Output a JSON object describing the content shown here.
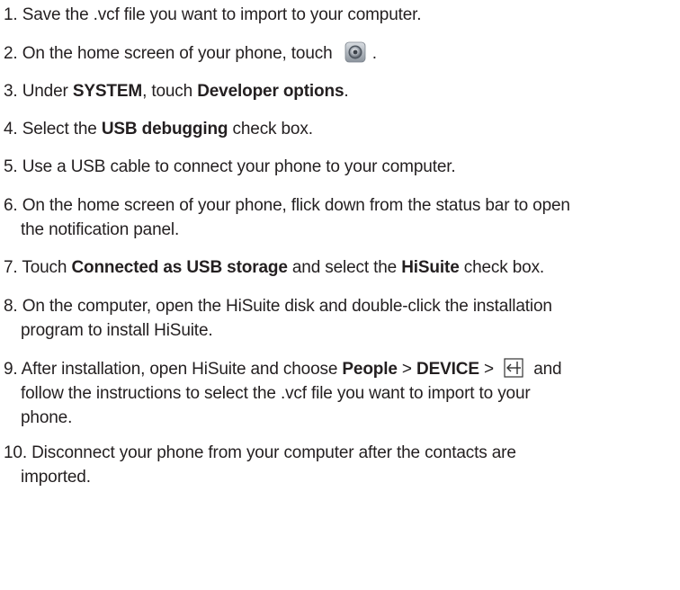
{
  "steps": [
    {
      "num": "1.",
      "segs": [
        {
          "t": "Save the .vcf file you want to import to your computer."
        }
      ]
    },
    {
      "num": "2.",
      "segs": [
        {
          "t": "On the home screen of your phone, touch "
        },
        {
          "icon": "settings-icon"
        },
        {
          "t": " ."
        }
      ]
    },
    {
      "num": "3.",
      "segs": [
        {
          "t": "Under "
        },
        {
          "t": "SYSTEM",
          "b": true
        },
        {
          "t": ", touch "
        },
        {
          "t": "Developer options",
          "b": true
        },
        {
          "t": "."
        }
      ]
    },
    {
      "num": "4.",
      "segs": [
        {
          "t": "Select the "
        },
        {
          "t": "USB debugging",
          "b": true
        },
        {
          "t": " check box."
        }
      ]
    },
    {
      "num": "5.",
      "segs": [
        {
          "t": "Use a USB cable to connect your phone to your computer."
        }
      ]
    },
    {
      "num": "6.",
      "segs": [
        {
          "t": "On the home screen of your phone, flick down from the status bar to open"
        }
      ],
      "cont": [
        {
          "t": "the notification panel."
        }
      ]
    },
    {
      "num": "7.",
      "segs": [
        {
          "t": "Touch "
        },
        {
          "t": "Connected as USB storage",
          "b": true
        },
        {
          "t": " and select the "
        },
        {
          "t": "HiSuite",
          "b": true
        },
        {
          "t": " check box."
        }
      ]
    },
    {
      "num": "8.",
      "segs": [
        {
          "t": "On the computer, open the HiSuite disk and double-click the installation"
        }
      ],
      "cont": [
        {
          "t": "program to install HiSuite."
        }
      ]
    },
    {
      "num": "9.",
      "segs": [
        {
          "t": "After installation, open HiSuite and choose "
        },
        {
          "t": "People",
          "b": true
        },
        {
          "t": " > "
        },
        {
          "t": "DEVICE",
          "b": true
        },
        {
          "t": " > "
        },
        {
          "icon": "import-icon"
        },
        {
          "t": " and"
        }
      ],
      "cont": [
        {
          "t": "follow the instructions to select the .vcf file you want to import to your"
        }
      ],
      "cont2": [
        {
          "t": "phone."
        }
      ]
    },
    {
      "num": "10.",
      "segs": [
        {
          "t": "Disconnect your phone from your computer after the contacts are"
        }
      ],
      "cont": [
        {
          "t": "imported."
        }
      ]
    }
  ],
  "icons": {
    "settings-icon": "settings-gear",
    "import-icon": "import-arrow"
  }
}
